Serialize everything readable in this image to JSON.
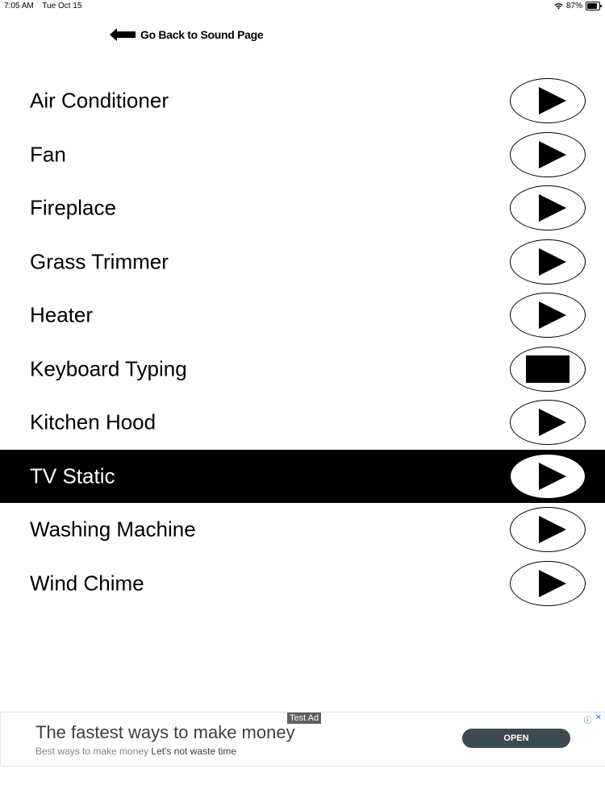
{
  "status_bar": {
    "time": "7:05 AM",
    "date": "Tue Oct 15",
    "battery": "87%",
    "battery_level": 0.87
  },
  "header": {
    "back_label": "Go Back to Sound Page"
  },
  "sounds": [
    {
      "label": "Air Conditioner",
      "state": "play"
    },
    {
      "label": "Fan",
      "state": "play"
    },
    {
      "label": "Fireplace",
      "state": "play"
    },
    {
      "label": "Grass Trimmer",
      "state": "play"
    },
    {
      "label": "Heater",
      "state": "play"
    },
    {
      "label": "Keyboard Typing",
      "state": "stop"
    },
    {
      "label": "Kitchen Hood",
      "state": "play"
    },
    {
      "label": "TV Static",
      "state": "play",
      "selected": true
    },
    {
      "label": "Washing Machine",
      "state": "play"
    },
    {
      "label": "Wind Chime",
      "state": "play"
    }
  ],
  "ad": {
    "tag": "Test Ad",
    "title": "The fastest ways to make money",
    "subtitle_prefix": "Best ways to make money",
    "subtitle_suffix": "Let's not waste time",
    "cta": "OPEN",
    "info_icon": "ⓘ",
    "close_icon": "✕"
  },
  "colors": {
    "selected_row_bg": "#000000",
    "ad_button_bg": "#3c4a52"
  }
}
